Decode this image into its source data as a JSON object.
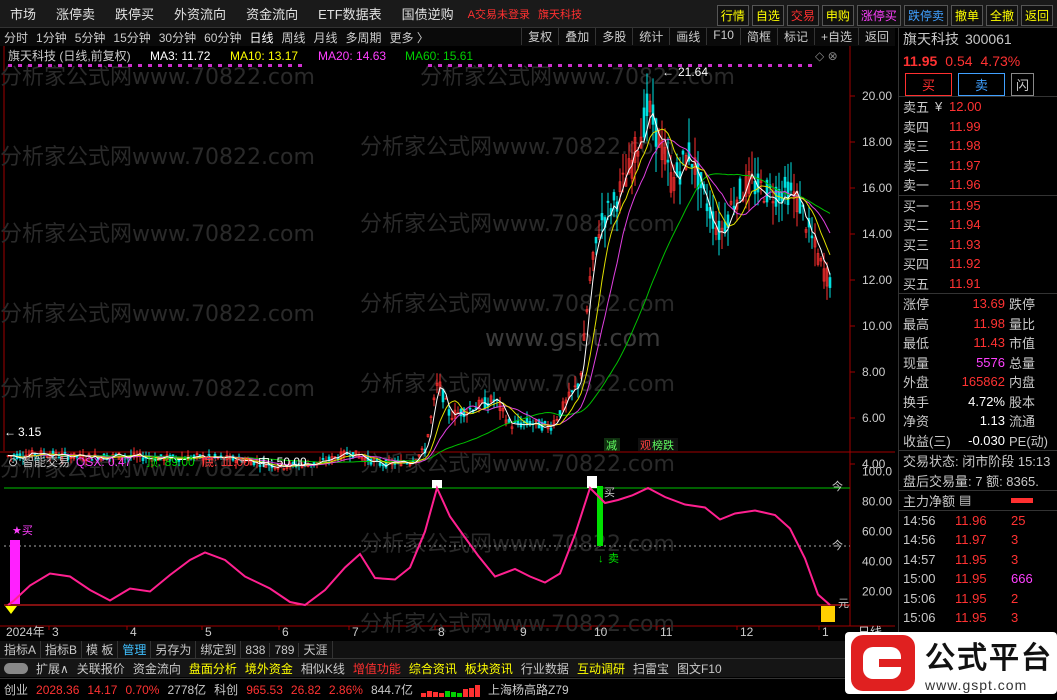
{
  "topbar": {
    "menus": [
      "市场",
      "涨停卖",
      "跌停买",
      "外资流向",
      "资金流向",
      "ETF数据表",
      "国债逆购"
    ],
    "warning": "A交易未登录",
    "stock_name": "旗天科技",
    "right_buttons": [
      {
        "label": "行情",
        "color": "#ffff00"
      },
      {
        "label": "自选",
        "color": "#ffff00"
      },
      {
        "label": "交易",
        "color": "#ff3030"
      },
      {
        "label": "申购",
        "color": "#ffff00"
      },
      {
        "label": "涨停买",
        "color": "#ff40ff"
      },
      {
        "label": "跌停卖",
        "color": "#40a0ff"
      },
      {
        "label": "撤单",
        "color": "#ffff00"
      },
      {
        "label": "全撤",
        "color": "#ffff00"
      },
      {
        "label": "返回",
        "color": "#ffff00"
      }
    ]
  },
  "toolbar": {
    "periods": [
      "分时",
      "1分钟",
      "5分钟",
      "15分钟",
      "30分钟",
      "60分钟",
      "日线",
      "周线",
      "月线",
      "多周期",
      "更多 〉"
    ],
    "active": "日线",
    "right": [
      "复权",
      "叠加",
      "多股",
      "统计",
      "画线",
      "F10",
      "简框",
      "标记",
      "+自选",
      "返回"
    ]
  },
  "main_chart": {
    "title": "旗天科技 (日线,前复权)",
    "ma3": "MA3: 11.72",
    "ma10": "MA10: 13.17",
    "ma20": "MA20: 14.63",
    "ma60": "MA60: 15.61",
    "high_label": "21.64",
    "low_label": "3.15",
    "y_ticks": [
      "20.00",
      "18.00",
      "16.00",
      "14.00",
      "12.00",
      "10.00",
      "8.00",
      "6.00",
      "4.00"
    ],
    "tags": [
      "减",
      "观",
      "榜跌"
    ],
    "watermark_1": "分析家公式网www.70822.com",
    "watermark_2": "www.gspt.com"
  },
  "indicator": {
    "name": "智能交易",
    "qsx": "QSX: 0.47",
    "top": "顶: 89.00",
    "bottom": "底: 11.00",
    "mid": "中: 50.00",
    "y_ticks": [
      "100.0",
      "80.00",
      "60.00",
      "40.00",
      "20.00"
    ],
    "buy": "★买",
    "sell": "卖",
    "buy2": "买",
    "top_tag": "今",
    "mid_tag": "今",
    "bottom_tag": "元"
  },
  "x_axis": {
    "year": "2024年",
    "months": [
      "3",
      "4",
      "5",
      "6",
      "7",
      "8",
      "9",
      "10",
      "11",
      "12",
      "1"
    ],
    "period": "日线"
  },
  "quote": {
    "name": "旗天科技",
    "code": "300061",
    "price": "11.95",
    "change": "0.54",
    "pct": "4.73%",
    "buy": "买",
    "sell": "卖",
    "flash": "闪",
    "asks": [
      {
        "l": "卖五",
        "p": "12.00"
      },
      {
        "l": "卖四",
        "p": "11.99"
      },
      {
        "l": "卖三",
        "p": "11.98"
      },
      {
        "l": "卖二",
        "p": "11.97"
      },
      {
        "l": "卖一",
        "p": "11.96"
      }
    ],
    "bids": [
      {
        "l": "买一",
        "p": "11.95"
      },
      {
        "l": "买二",
        "p": "11.94"
      },
      {
        "l": "买三",
        "p": "11.93"
      },
      {
        "l": "买四",
        "p": "11.92"
      },
      {
        "l": "买五",
        "p": "11.91"
      }
    ],
    "ask_prefix": "¥",
    "stats": [
      {
        "l": "涨停",
        "v": "13.69",
        "c": "red",
        "r": "跌停"
      },
      {
        "l": "最高",
        "v": "11.98",
        "c": "red",
        "r": "量比"
      },
      {
        "l": "最低",
        "v": "11.43",
        "c": "red",
        "r": "市值"
      },
      {
        "l": "现量",
        "v": "5576",
        "c": "mag",
        "r": "总量"
      },
      {
        "l": "外盘",
        "v": "165862",
        "c": "red",
        "r": "内盘"
      },
      {
        "l": "换手",
        "v": "4.72%",
        "c": "wht",
        "r": "股本"
      },
      {
        "l": "净资",
        "v": "1.13",
        "c": "wht",
        "r": "流通"
      },
      {
        "l": "收益(三)",
        "v": "-0.030",
        "c": "wht",
        "r": "PE(动)"
      }
    ],
    "trade_status": "交易状态: 闭市阶段 15:13",
    "after_hours": "盘后交易量: 7  额: 8365.",
    "main_flow": "主力净额",
    "ticks": [
      {
        "t": "14:56",
        "p": "11.96",
        "v": "25"
      },
      {
        "t": "14:56",
        "p": "11.97",
        "v": "3"
      },
      {
        "t": "14:57",
        "p": "11.95",
        "v": "3"
      },
      {
        "t": "15:00",
        "p": "11.95",
        "v": "666"
      },
      {
        "t": "15:06",
        "p": "11.95",
        "v": "2"
      },
      {
        "t": "15:06",
        "p": "11.95",
        "v": "3"
      },
      {
        "t": "15:08",
        "p": "11.95",
        "v": ""
      }
    ]
  },
  "bottom_tabs": [
    "指标A",
    "指标B",
    "模 板",
    "管理",
    "另存为",
    "绑定到",
    "838",
    "789",
    "天涯"
  ],
  "bottom_tabs2": [
    "扩展∧",
    "关联报价",
    "资金流向",
    "盘面分析",
    "境外资金",
    "相似K线",
    "增值功能",
    "综合资讯",
    "板块资讯",
    "行业数据",
    "互动调研",
    "扫雷宝",
    "图文F10"
  ],
  "status": {
    "cy_name": "创业",
    "cy_val": "2028.36",
    "cy_chg": "14.17",
    "cy_pct": "0.70%",
    "cy_amt": "2778亿",
    "kc_name": "科创",
    "kc_val": "965.53",
    "kc_chg": "26.82",
    "kc_pct": "2.86%",
    "kc_amt": "844.7亿",
    "loc": "上海杨高路Z79"
  },
  "logo": {
    "text": "公式平台",
    "url": "www.gspt.com"
  }
}
